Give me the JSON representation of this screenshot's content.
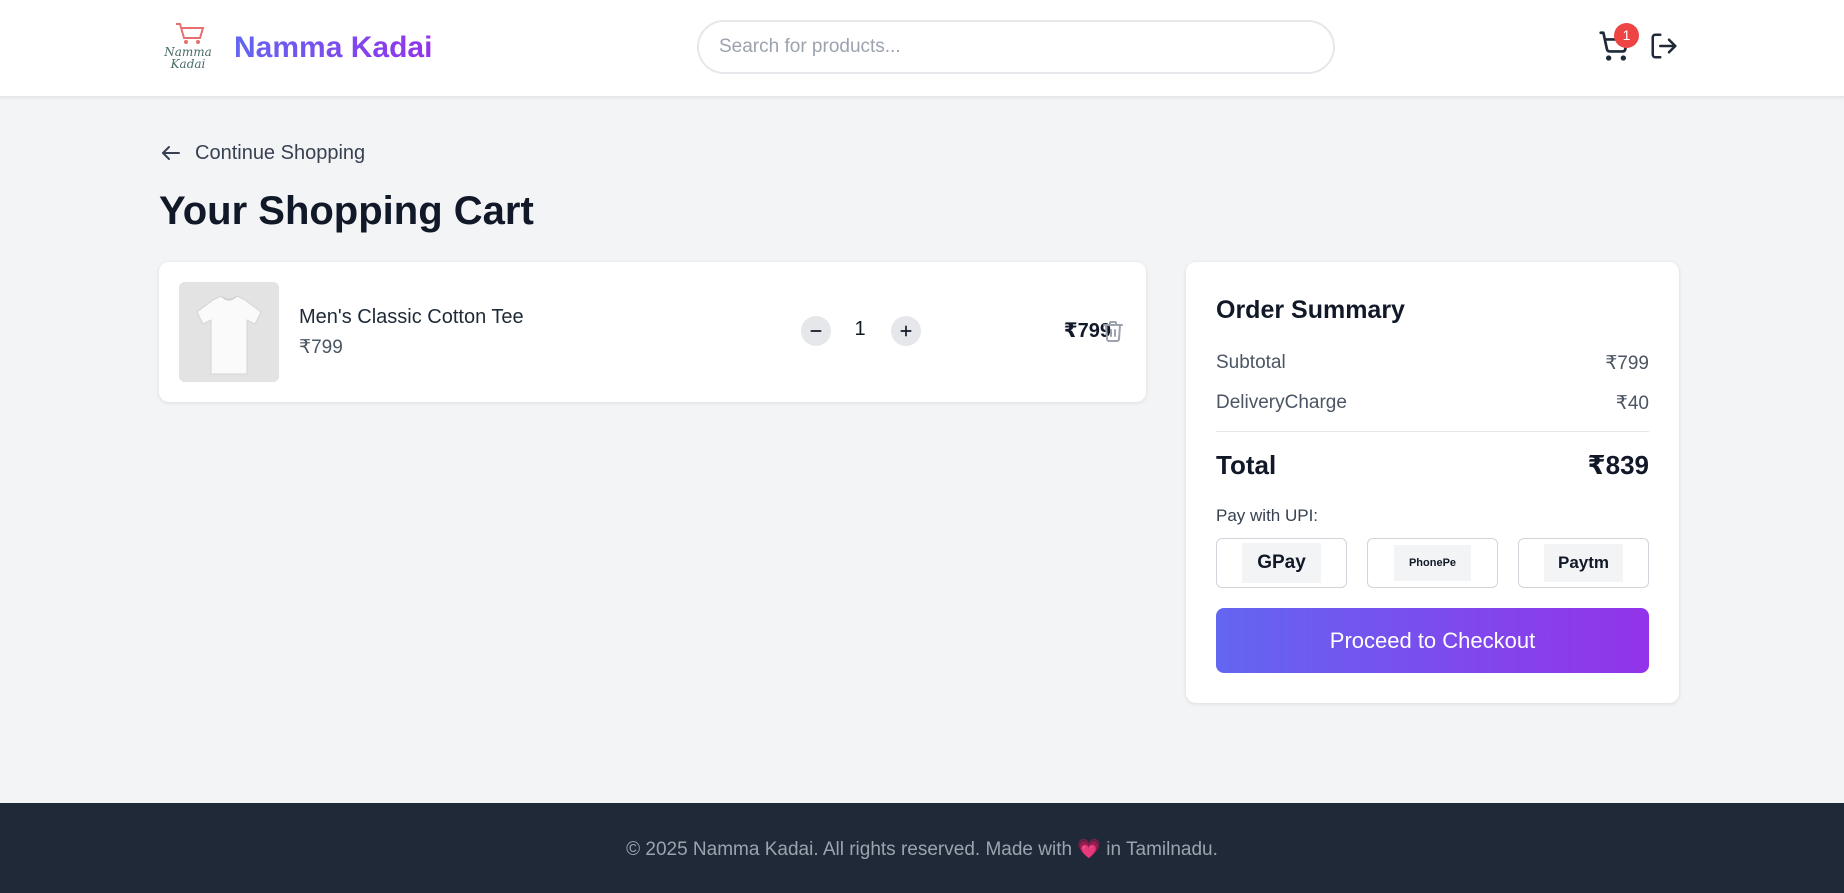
{
  "header": {
    "brand": "Namma Kadai",
    "logo_text_line1": "Namma",
    "logo_text_line2": "Kadai",
    "search_placeholder": "Search for products...",
    "cart_count": "1",
    "icons": [
      "cart-icon",
      "logout-icon"
    ]
  },
  "page": {
    "back_label": "Continue Shopping",
    "title": "Your Shopping Cart"
  },
  "cart": {
    "items": [
      {
        "name": "Men's Classic Cotton Tee",
        "price": "₹799",
        "quantity": "1",
        "line_total": "₹799"
      }
    ]
  },
  "summary": {
    "title": "Order Summary",
    "subtotal_label": "Subtotal",
    "subtotal_value": "₹799",
    "delivery_label": "DeliveryCharge",
    "delivery_value": "₹40",
    "total_label": "Total",
    "total_value": "₹839",
    "upi_label": "Pay with UPI:",
    "upi_options": [
      "GPay",
      "PhonePe",
      "Paytm"
    ],
    "checkout_label": "Proceed to Checkout"
  },
  "footer": {
    "text_before": "© 2025 Namma Kadai. All rights reserved. Made with",
    "heart": "💗",
    "text_after": "in Tamilnadu."
  },
  "colors": {
    "accent_start": "#6366f1",
    "accent_end": "#9333ea",
    "badge": "#ef4444",
    "footer_bg": "#1f2937",
    "page_bg": "#f3f4f6"
  }
}
